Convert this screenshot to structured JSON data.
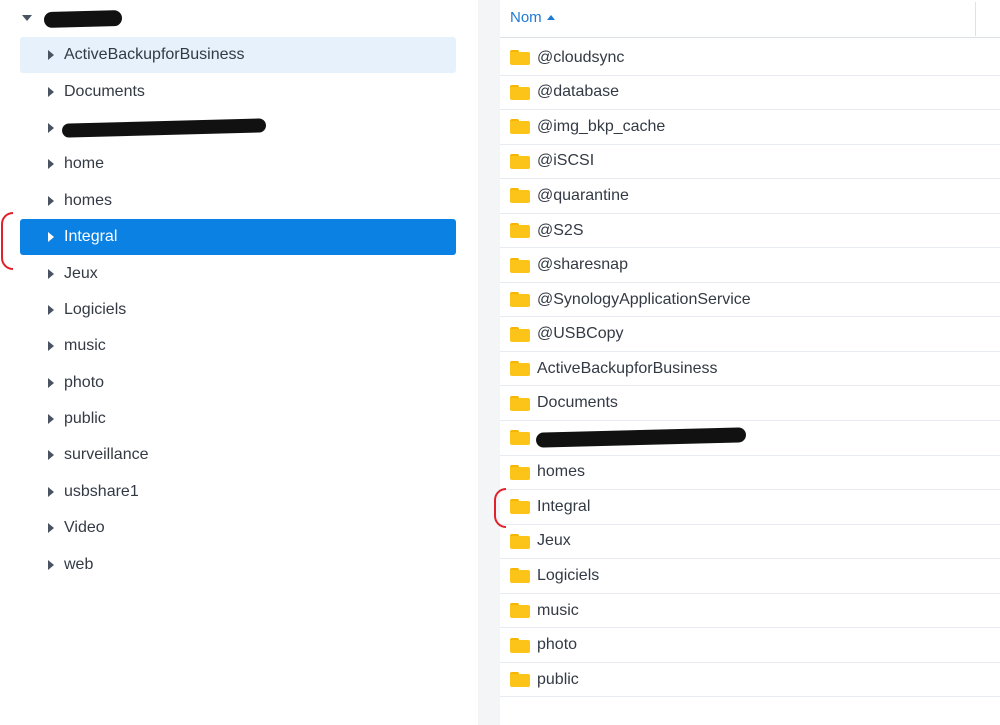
{
  "tree": {
    "root_label": "",
    "items": [
      {
        "label": "ActiveBackupforBusiness",
        "state": "hover"
      },
      {
        "label": "Documents",
        "state": ""
      },
      {
        "label": "",
        "state": "redacted"
      },
      {
        "label": "home",
        "state": ""
      },
      {
        "label": "homes",
        "state": ""
      },
      {
        "label": "Integral",
        "state": "selected"
      },
      {
        "label": "Jeux",
        "state": ""
      },
      {
        "label": "Logiciels",
        "state": ""
      },
      {
        "label": "music",
        "state": ""
      },
      {
        "label": "photo",
        "state": ""
      },
      {
        "label": "public",
        "state": ""
      },
      {
        "label": "surveillance",
        "state": ""
      },
      {
        "label": "usbshare1",
        "state": ""
      },
      {
        "label": "Video",
        "state": ""
      },
      {
        "label": "web",
        "state": ""
      }
    ]
  },
  "list": {
    "header": {
      "name_label": "Nom"
    },
    "rows": [
      {
        "name": "@cloudsync"
      },
      {
        "name": "@database"
      },
      {
        "name": "@img_bkp_cache"
      },
      {
        "name": "@iSCSI"
      },
      {
        "name": "@quarantine"
      },
      {
        "name": "@S2S"
      },
      {
        "name": "@sharesnap"
      },
      {
        "name": "@SynologyApplicationService"
      },
      {
        "name": "@USBCopy"
      },
      {
        "name": "ActiveBackupforBusiness"
      },
      {
        "name": "Documents"
      },
      {
        "name": ""
      },
      {
        "name": "homes"
      },
      {
        "name": "Integral"
      },
      {
        "name": "Jeux"
      },
      {
        "name": "Logiciels"
      },
      {
        "name": "music"
      },
      {
        "name": "photo"
      },
      {
        "name": "public"
      }
    ]
  },
  "colors": {
    "selected": "#0b82e3",
    "hover": "#e6f1fc",
    "accent": "#1f7ad6",
    "folder": "#fcc419",
    "annotation": "#e0202a"
  }
}
